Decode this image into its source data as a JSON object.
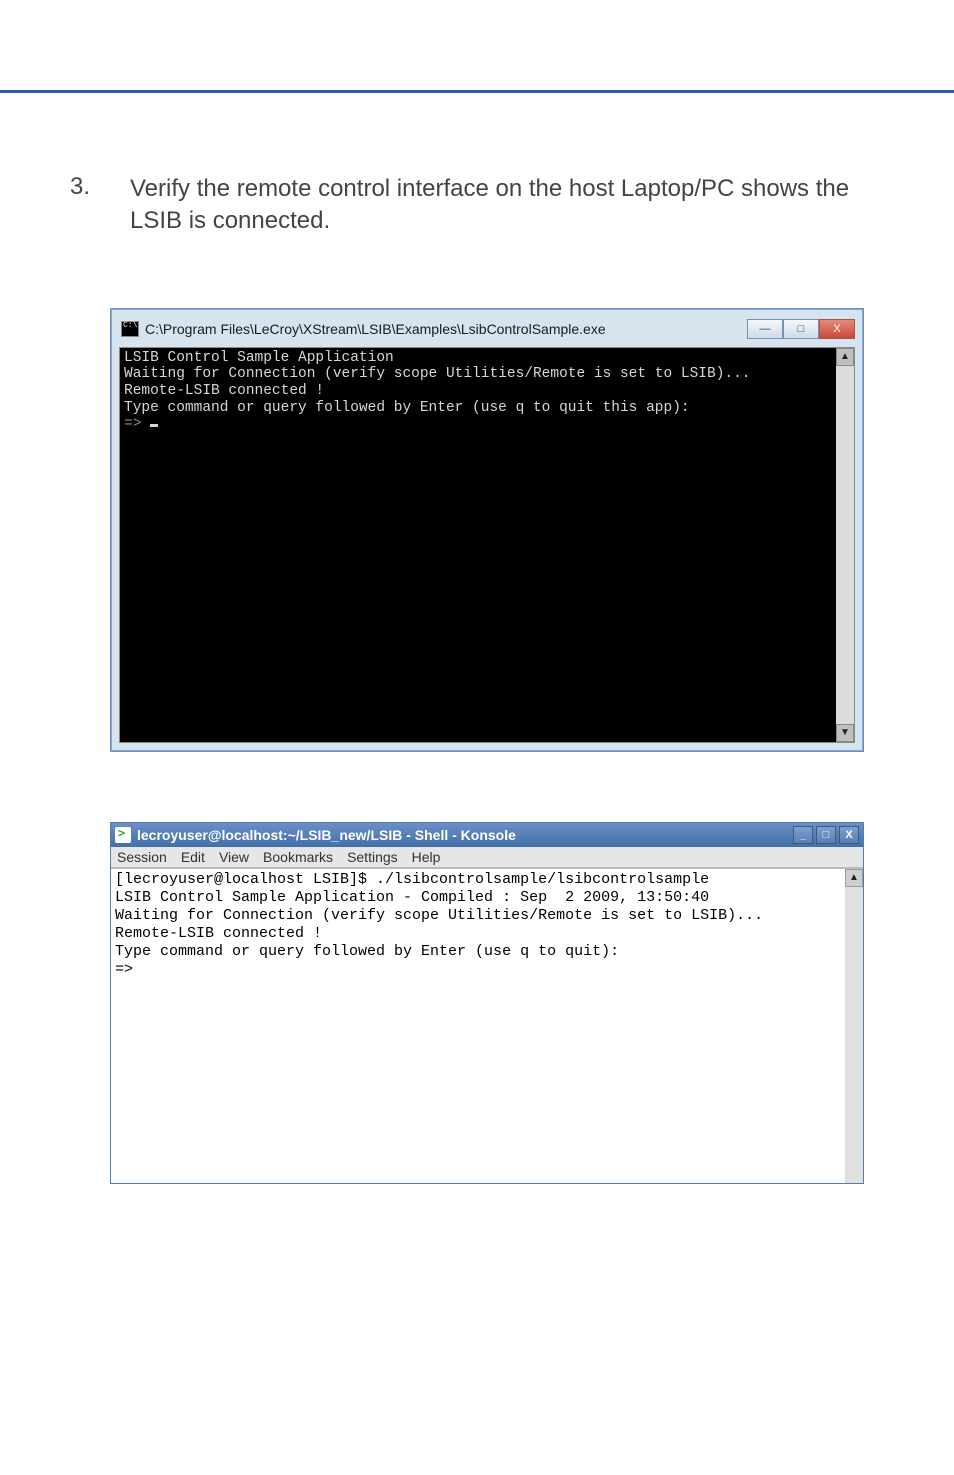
{
  "page": {
    "step_number": "3.",
    "step_text": "Verify the remote control interface on the host Laptop/PC shows the LSIB is connected."
  },
  "cmd_window": {
    "title": "C:\\Program Files\\LeCroy\\XStream\\LSIB\\Examples\\LsibControlSample.exe",
    "buttons": {
      "min": "—",
      "max": "□",
      "close": "X"
    },
    "line1": "LSIB Control Sample Application",
    "line2": "Waiting for Connection (verify scope Utilities/Remote is set to LSIB)...",
    "line3": "Remote-LSIB connected !",
    "line4": "Type command or query followed by Enter (use q to quit this app):",
    "prompt": "=>"
  },
  "kde_window": {
    "title": "lecroyuser@localhost:~/LSIB_new/LSIB - Shell - Konsole",
    "buttons": {
      "min": "_",
      "max": "□",
      "close": "X"
    },
    "menu": [
      "Session",
      "Edit",
      "View",
      "Bookmarks",
      "Settings",
      "Help"
    ],
    "line1": "[lecroyuser@localhost LSIB]$ ./lsibcontrolsample/lsibcontrolsample",
    "line2": "LSIB Control Sample Application - Compiled : Sep  2 2009, 13:50:40",
    "line3": "Waiting for Connection (verify scope Utilities/Remote is set to LSIB)...",
    "line4": "Remote-LSIB connected !",
    "line5": "Type command or query followed by Enter (use q to quit):",
    "prompt": "=>"
  }
}
